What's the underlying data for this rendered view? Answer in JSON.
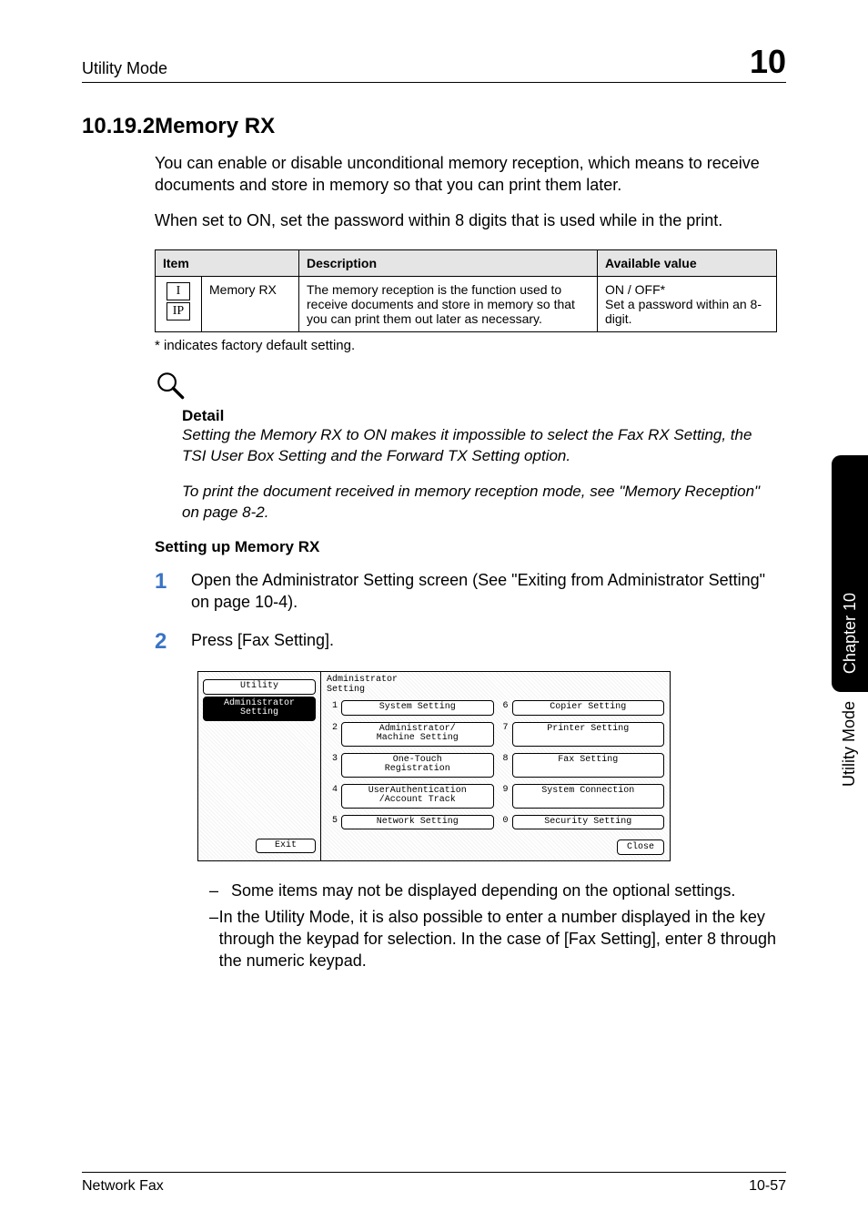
{
  "header": {
    "left": "Utility Mode",
    "chapter_number": "10"
  },
  "side_tab": {
    "chapter_label": "Chapter 10",
    "mode_label": "Utility Mode"
  },
  "section": {
    "number_title": "10.19.2Memory RX",
    "intro_p1": "You can enable or disable unconditional memory reception, which means to receive documents and store in memory so that you can print them later.",
    "intro_p2": "When set to ON, set the password within 8 digits that is used while in the print."
  },
  "table": {
    "headers": {
      "item": "Item",
      "desc": "Description",
      "avail": "Available value"
    },
    "row": {
      "icons": [
        "I",
        "IP"
      ],
      "name": "Memory RX",
      "desc": "The memory reception is the function used to receive documents and store in memory so that you can print them out later as necessary.",
      "avail": "ON / OFF*\nSet a password within an 8-digit."
    }
  },
  "footnote": "* indicates factory default setting.",
  "detail": {
    "label": "Detail",
    "p1": "Setting the Memory RX to ON makes it impossible to select the Fax RX Setting, the TSI User Box Setting and the Forward TX Setting option.",
    "p2": "To print the document received in memory reception mode, see \"Memory Reception\" on page 8-2."
  },
  "procedure": {
    "heading": "Setting up Memory RX",
    "steps": [
      {
        "n": "1",
        "text": "Open the Administrator Setting screen (See \"Exiting from Administrator Setting\" on page 10-4)."
      },
      {
        "n": "2",
        "text": "Press [Fax Setting]."
      }
    ]
  },
  "screenshot": {
    "left": {
      "utility": "Utility",
      "admin": "Administrator\nSetting",
      "exit": "Exit"
    },
    "title": "Administrator\nSetting",
    "buttons": [
      {
        "n": "1",
        "label": "System Setting"
      },
      {
        "n": "6",
        "label": "Copier Setting"
      },
      {
        "n": "2",
        "label": "Administrator/\nMachine Setting"
      },
      {
        "n": "7",
        "label": "Printer Setting"
      },
      {
        "n": "3",
        "label": "One-Touch\nRegistration"
      },
      {
        "n": "8",
        "label": "Fax Setting"
      },
      {
        "n": "4",
        "label": "UserAuthentication\n/Account Track"
      },
      {
        "n": "9",
        "label": "System Connection"
      },
      {
        "n": "5",
        "label": "Network Setting"
      },
      {
        "n": "0",
        "label": "Security Setting"
      }
    ],
    "close": "Close"
  },
  "notes": {
    "b1": "Some items may not be displayed depending on the optional settings.",
    "b2": "In the Utility Mode, it is also possible to enter a number displayed in the key through the keypad for selection. In the case of [Fax Setting], enter 8 through the numeric keypad."
  },
  "footer": {
    "left": "Network Fax",
    "right": "10-57"
  }
}
